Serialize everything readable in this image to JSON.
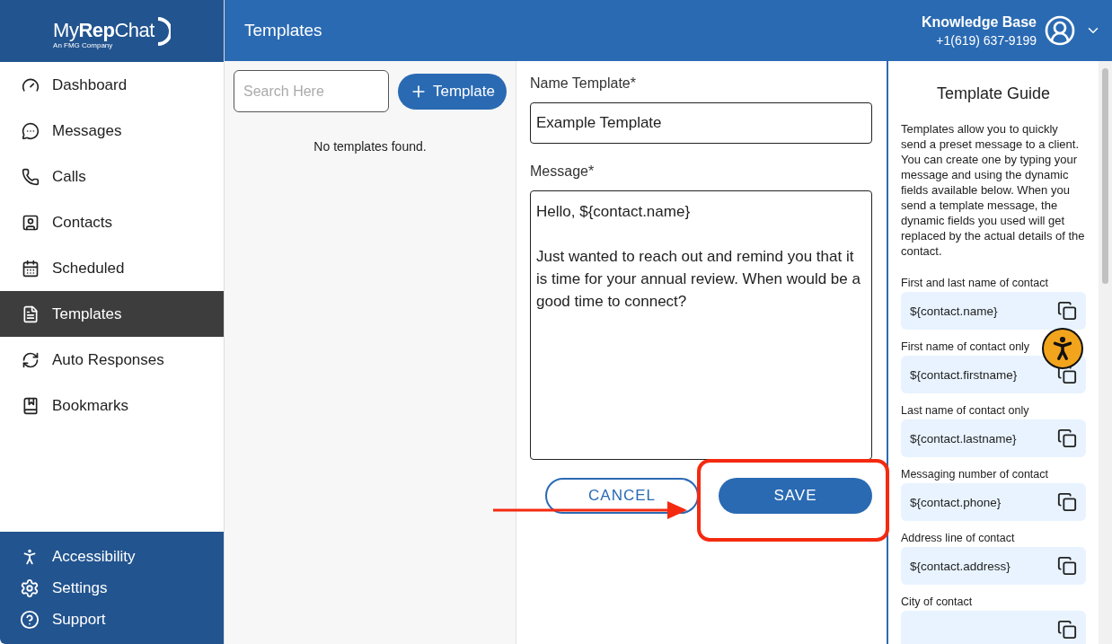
{
  "logo": {
    "name": "My**Rep**Chat",
    "tagline": "An FMG Company"
  },
  "header": {
    "title": "Templates",
    "account": "Knowledge Base",
    "phone": "+1(619) 637-9199"
  },
  "sidebar": {
    "items": [
      {
        "label": "Dashboard",
        "selected": false
      },
      {
        "label": "Messages",
        "selected": false
      },
      {
        "label": "Calls",
        "selected": false
      },
      {
        "label": "Contacts",
        "selected": false
      },
      {
        "label": "Scheduled",
        "selected": false
      },
      {
        "label": "Templates",
        "selected": true
      },
      {
        "label": "Auto Responses",
        "selected": false
      },
      {
        "label": "Bookmarks",
        "selected": false
      }
    ],
    "footer": [
      {
        "label": "Accessibility"
      },
      {
        "label": "Settings"
      },
      {
        "label": "Support"
      }
    ]
  },
  "list": {
    "search_placeholder": "Search Here",
    "add_button": "Template",
    "empty": "No templates found."
  },
  "form": {
    "name_label": "Name Template*",
    "name_value": "Example Template",
    "message_label": "Message*",
    "message_value": "Hello, ${contact.name}\n\nJust wanted to reach out and remind you that it is time for your annual review. When would be a good time to connect?",
    "cancel": "CANCEL",
    "save": "SAVE"
  },
  "guide": {
    "title": "Template Guide",
    "intro": "Templates allow you to quickly send a preset message to a client. You can create one by typing your message and using the dynamic fields available below. When you send a template message, the dynamic fields you used will get replaced by the actual details of the contact.",
    "fields": [
      {
        "label": "First and last name of contact",
        "value": "${contact.name}"
      },
      {
        "label": "First name of contact only",
        "value": "${contact.firstname}"
      },
      {
        "label": "Last name of contact only",
        "value": "${contact.lastname}"
      },
      {
        "label": "Messaging number of contact",
        "value": "${contact.phone}"
      },
      {
        "label": "Address line of contact",
        "value": "${contact.address}"
      },
      {
        "label": "City of contact"
      }
    ]
  }
}
